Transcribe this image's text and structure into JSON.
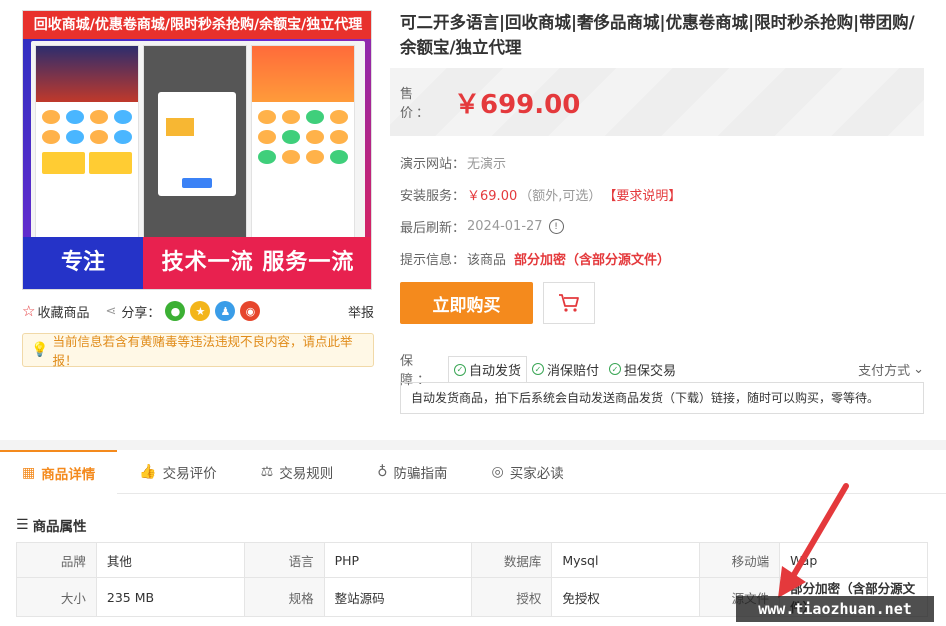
{
  "banner": {
    "title": "回收商城/优惠卷商城/限时秒杀抢购/余额宝/独立代理",
    "slogan_left": "专注",
    "slogan_right": "技术一流 服务一流"
  },
  "actions": {
    "favorite_label": "收藏商品",
    "share_label": "分享：",
    "report_label": "举报"
  },
  "notice": "当前信息若含有黄赌毒等违法违规不良内容，请点此举报！",
  "product": {
    "title": "可二开多语言|回收商城|奢侈品商城|优惠卷商城|限时秒杀抢购|带团购/余额宝/独立代理",
    "price_label": "售 价：",
    "price": "￥699.00"
  },
  "info": {
    "demo_label": "演示网站：",
    "demo_value": "无演示",
    "install_label": "安装服务：",
    "install_price": "￥69.00",
    "install_note": "（额外,可选）",
    "install_link": "【要求说明】",
    "refresh_label": "最后刷新：",
    "refresh_value": "2024-01-27",
    "tip_label": "提示信息：",
    "tip_value": "该商品",
    "tip_highlight": "部分加密（含部分源文件）"
  },
  "buy": {
    "buy_label": "立即购买",
    "cart_icon": "cart-icon"
  },
  "guarantee": {
    "label": "保 障：",
    "items": [
      "自动发货",
      "消保赔付",
      "担保交易"
    ],
    "pay_label": "支付方式",
    "description": "自动发货商品，拍下后系统会自动发送商品发货（下载）链接，随时可以购买，零等待。"
  },
  "tabs": [
    {
      "label": "商品详情",
      "icon": "grid-icon"
    },
    {
      "label": "交易评价",
      "icon": "thumb-icon"
    },
    {
      "label": "交易规则",
      "icon": "scale-icon"
    },
    {
      "label": "防骗指南",
      "icon": "bulb-icon"
    },
    {
      "label": "买家必读",
      "icon": "target-icon"
    }
  ],
  "attributes": {
    "title": "商品属性",
    "rows": [
      [
        {
          "k": "品牌",
          "v": "其他"
        },
        {
          "k": "语言",
          "v": "PHP"
        },
        {
          "k": "数据库",
          "v": "Mysql"
        },
        {
          "k": "移动端",
          "v": "Wap"
        }
      ],
      [
        {
          "k": "大小",
          "v": "235 MB"
        },
        {
          "k": "规格",
          "v": "整站源码"
        },
        {
          "k": "授权",
          "v": "免授权"
        },
        {
          "k": "源文件",
          "v": "部分加密（含部分源文件）"
        }
      ]
    ]
  },
  "watermark": "www.tiaozhuan.net",
  "colors": {
    "accent": "#f48a1d",
    "price": "#e4393c",
    "check": "#3aa655"
  }
}
